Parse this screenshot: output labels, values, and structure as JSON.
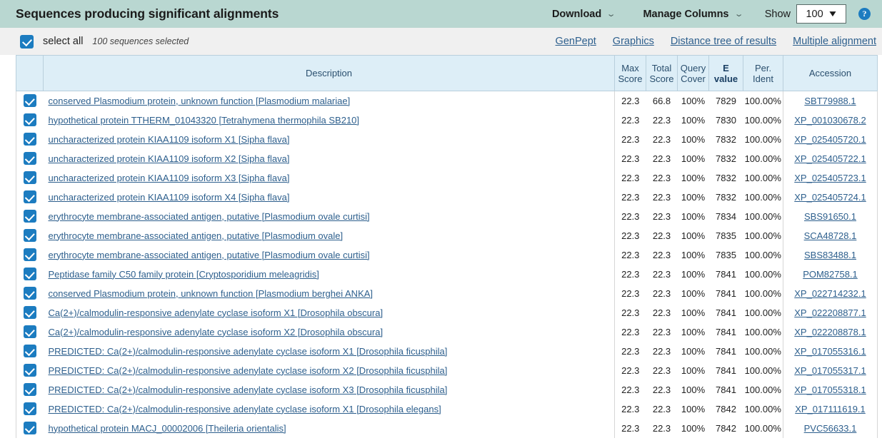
{
  "header": {
    "title": "Sequences producing significant alignments",
    "download_label": "Download",
    "manage_columns_label": "Manage Columns",
    "show_label": "Show",
    "show_value": "100",
    "help_glyph": "?",
    "caret_glyph": "⌄",
    "select_caret_glyph": "▼",
    "bar_color": "#b9d7d1"
  },
  "select_band": {
    "select_all_label": "select all",
    "selected_count": "100 sequences selected",
    "links": [
      {
        "label": "GenPept"
      },
      {
        "label": "Graphics"
      },
      {
        "label": "Distance tree of results"
      },
      {
        "label": "Multiple alignment"
      }
    ],
    "link_color": "#2d5f8d",
    "checkbox_color": "#1c7cc0"
  },
  "table": {
    "columns": [
      {
        "key": "checkbox",
        "label": ""
      },
      {
        "key": "description",
        "label": "Description",
        "sorted": false
      },
      {
        "key": "max_score",
        "label": "Max\nScore",
        "line1": "Max",
        "line2": "Score",
        "sorted": false
      },
      {
        "key": "total_score",
        "label": "Total\nScore",
        "line1": "Total",
        "line2": "Score",
        "sorted": false
      },
      {
        "key": "query_cover",
        "label": "Query\nCover",
        "line1": "Query",
        "line2": "Cover",
        "sorted": false
      },
      {
        "key": "e_value",
        "label": "E\nvalue",
        "line1": "E",
        "line2": "value",
        "sorted": true
      },
      {
        "key": "per_ident",
        "label": "Per.\nIdent",
        "line1": "Per.",
        "line2": "Ident",
        "sorted": false
      },
      {
        "key": "accession",
        "label": "Accession",
        "sorted": false
      }
    ],
    "rows": [
      {
        "checked": true,
        "description": "conserved Plasmodium protein, unknown function [Plasmodium malariae]",
        "max_score": "22.3",
        "total_score": "66.8",
        "query_cover": "100%",
        "e_value": "7829",
        "per_ident": "100.00%",
        "accession": "SBT79988.1"
      },
      {
        "checked": true,
        "description": "hypothetical protein TTHERM_01043320 [Tetrahymena thermophila SB210]",
        "max_score": "22.3",
        "total_score": "22.3",
        "query_cover": "100%",
        "e_value": "7830",
        "per_ident": "100.00%",
        "accession": "XP_001030678.2"
      },
      {
        "checked": true,
        "description": "uncharacterized protein KIAA1109 isoform X1 [Sipha flava]",
        "max_score": "22.3",
        "total_score": "22.3",
        "query_cover": "100%",
        "e_value": "7832",
        "per_ident": "100.00%",
        "accession": "XP_025405720.1"
      },
      {
        "checked": true,
        "description": "uncharacterized protein KIAA1109 isoform X2 [Sipha flava]",
        "max_score": "22.3",
        "total_score": "22.3",
        "query_cover": "100%",
        "e_value": "7832",
        "per_ident": "100.00%",
        "accession": "XP_025405722.1"
      },
      {
        "checked": true,
        "description": "uncharacterized protein KIAA1109 isoform X3 [Sipha flava]",
        "max_score": "22.3",
        "total_score": "22.3",
        "query_cover": "100%",
        "e_value": "7832",
        "per_ident": "100.00%",
        "accession": "XP_025405723.1"
      },
      {
        "checked": true,
        "description": "uncharacterized protein KIAA1109 isoform X4 [Sipha flava]",
        "max_score": "22.3",
        "total_score": "22.3",
        "query_cover": "100%",
        "e_value": "7832",
        "per_ident": "100.00%",
        "accession": "XP_025405724.1"
      },
      {
        "checked": true,
        "description": "erythrocyte membrane-associated antigen, putative [Plasmodium ovale curtisi]",
        "max_score": "22.3",
        "total_score": "22.3",
        "query_cover": "100%",
        "e_value": "7834",
        "per_ident": "100.00%",
        "accession": "SBS91650.1"
      },
      {
        "checked": true,
        "description": "erythrocyte membrane-associated antigen, putative [Plasmodium ovale]",
        "max_score": "22.3",
        "total_score": "22.3",
        "query_cover": "100%",
        "e_value": "7835",
        "per_ident": "100.00%",
        "accession": "SCA48728.1"
      },
      {
        "checked": true,
        "description": "erythrocyte membrane-associated antigen, putative [Plasmodium ovale curtisi]",
        "max_score": "22.3",
        "total_score": "22.3",
        "query_cover": "100%",
        "e_value": "7835",
        "per_ident": "100.00%",
        "accession": "SBS83488.1"
      },
      {
        "checked": true,
        "description": "Peptidase family C50 family protein [Cryptosporidium meleagridis]",
        "max_score": "22.3",
        "total_score": "22.3",
        "query_cover": "100%",
        "e_value": "7841",
        "per_ident": "100.00%",
        "accession": "POM82758.1"
      },
      {
        "checked": true,
        "description": "conserved Plasmodium protein, unknown function [Plasmodium berghei ANKA]",
        "max_score": "22.3",
        "total_score": "22.3",
        "query_cover": "100%",
        "e_value": "7841",
        "per_ident": "100.00%",
        "accession": "XP_022714232.1"
      },
      {
        "checked": true,
        "description": "Ca(2+)/calmodulin-responsive adenylate cyclase isoform X1 [Drosophila obscura]",
        "max_score": "22.3",
        "total_score": "22.3",
        "query_cover": "100%",
        "e_value": "7841",
        "per_ident": "100.00%",
        "accession": "XP_022208877.1"
      },
      {
        "checked": true,
        "description": "Ca(2+)/calmodulin-responsive adenylate cyclase isoform X2 [Drosophila obscura]",
        "max_score": "22.3",
        "total_score": "22.3",
        "query_cover": "100%",
        "e_value": "7841",
        "per_ident": "100.00%",
        "accession": "XP_022208878.1"
      },
      {
        "checked": true,
        "description": "PREDICTED: Ca(2+)/calmodulin-responsive adenylate cyclase isoform X1 [Drosophila ficusphila]",
        "max_score": "22.3",
        "total_score": "22.3",
        "query_cover": "100%",
        "e_value": "7841",
        "per_ident": "100.00%",
        "accession": "XP_017055316.1"
      },
      {
        "checked": true,
        "description": "PREDICTED: Ca(2+)/calmodulin-responsive adenylate cyclase isoform X2 [Drosophila ficusphila]",
        "max_score": "22.3",
        "total_score": "22.3",
        "query_cover": "100%",
        "e_value": "7841",
        "per_ident": "100.00%",
        "accession": "XP_017055317.1"
      },
      {
        "checked": true,
        "description": "PREDICTED: Ca(2+)/calmodulin-responsive adenylate cyclase isoform X3 [Drosophila ficusphila]",
        "max_score": "22.3",
        "total_score": "22.3",
        "query_cover": "100%",
        "e_value": "7841",
        "per_ident": "100.00%",
        "accession": "XP_017055318.1"
      },
      {
        "checked": true,
        "description": "PREDICTED: Ca(2+)/calmodulin-responsive adenylate cyclase isoform X1 [Drosophila elegans]",
        "max_score": "22.3",
        "total_score": "22.3",
        "query_cover": "100%",
        "e_value": "7842",
        "per_ident": "100.00%",
        "accession": "XP_017111619.1"
      },
      {
        "checked": true,
        "description": "hypothetical protein MACJ_00002006 [Theileria orientalis]",
        "max_score": "22.3",
        "total_score": "22.3",
        "query_cover": "100%",
        "e_value": "7842",
        "per_ident": "100.00%",
        "accession": "PVC56633.1"
      }
    ]
  }
}
